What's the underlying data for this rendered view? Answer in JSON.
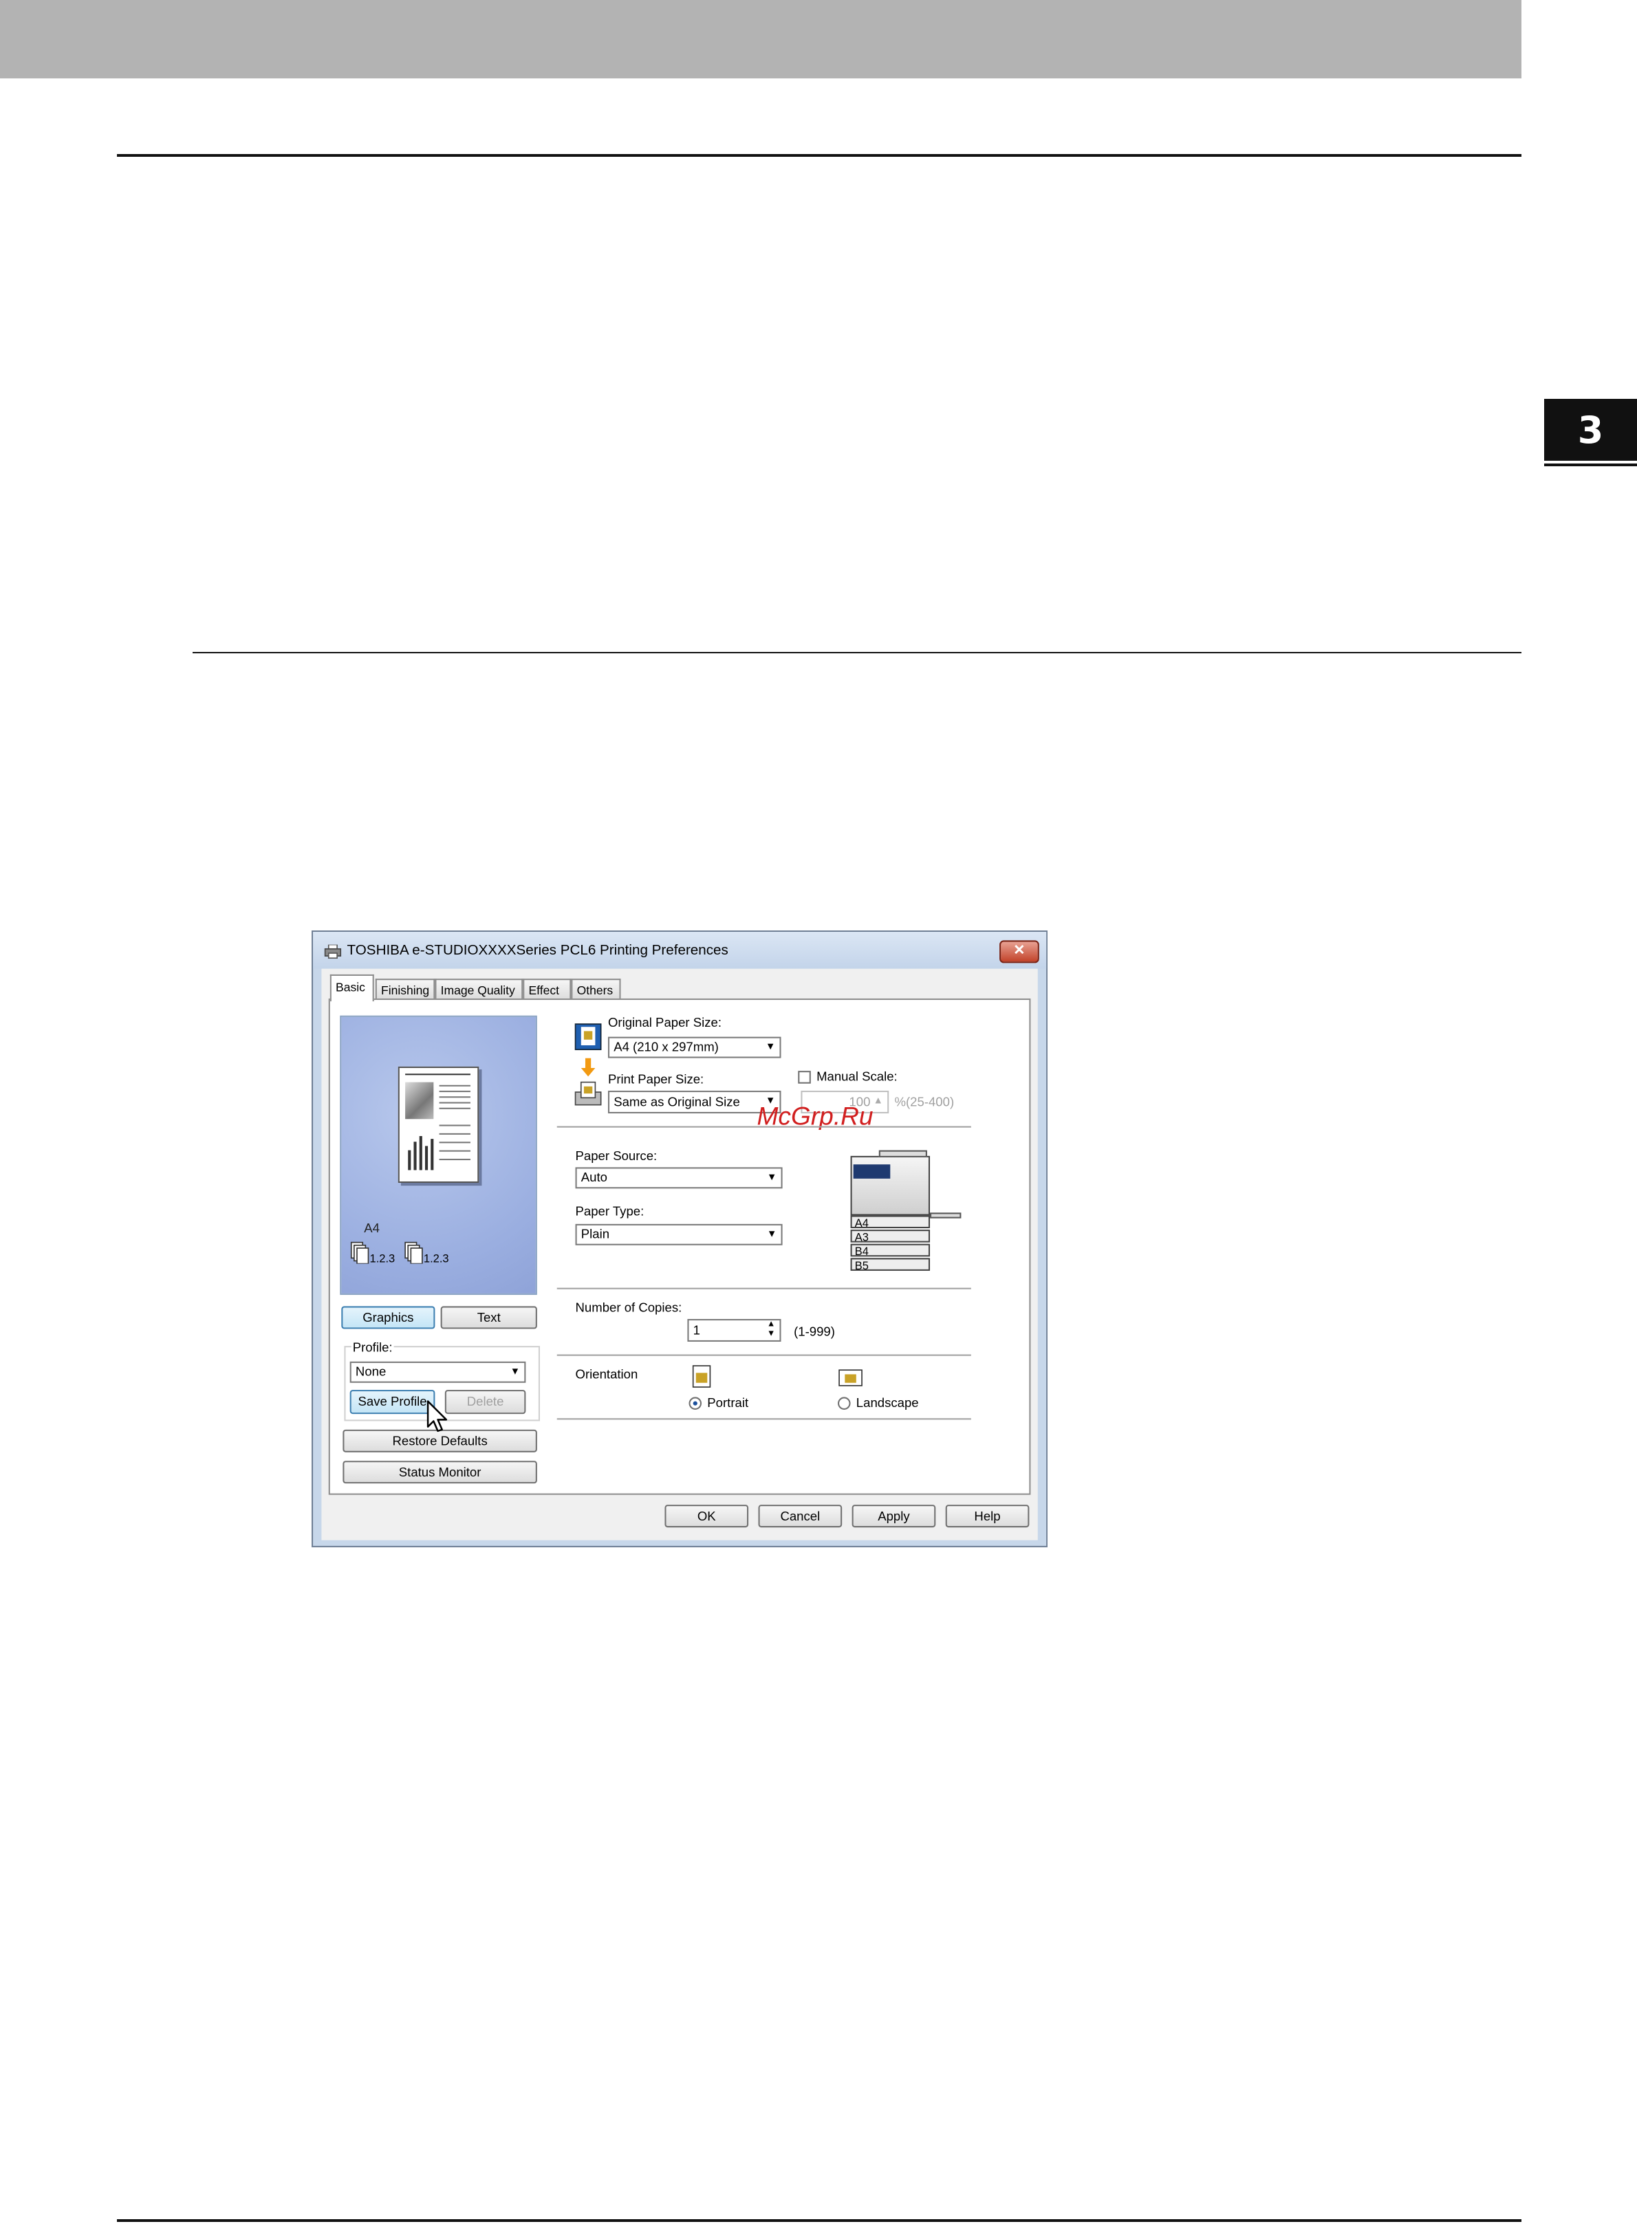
{
  "dialog": {
    "title": "TOSHIBA e-STUDIOXXXXSeries PCL6 Printing Preferences",
    "close_glyph": "✕",
    "tabs": [
      "Basic",
      "Finishing",
      "Image Quality",
      "Effect",
      "Others"
    ],
    "active_tab": "Basic",
    "preview": {
      "paper_size_label": "A4",
      "collate_label_1": "1.2.3",
      "collate_label_2": "1.2.3"
    },
    "view_buttons": {
      "graphics": "Graphics",
      "text": "Text"
    },
    "profile": {
      "label": "Profile:",
      "value": "None",
      "save_button": "Save Profile",
      "delete_button": "Delete"
    },
    "restore_defaults_button": "Restore Defaults",
    "status_monitor_button": "Status Monitor",
    "original_paper_size": {
      "label": "Original Paper Size:",
      "value": "A4 (210 x 297mm)"
    },
    "print_paper_size": {
      "label": "Print Paper Size:",
      "value": "Same as Original Size"
    },
    "manual_scale": {
      "label": "Manual Scale:",
      "value": "100",
      "range": "%(25-400)",
      "checked": false
    },
    "paper_source": {
      "label": "Paper Source:",
      "value": "Auto"
    },
    "paper_type": {
      "label": "Paper Type:",
      "value": "Plain"
    },
    "printer_trays": [
      "A4",
      "A3",
      "B4",
      "B5"
    ],
    "copies": {
      "label": "Number of Copies:",
      "value": "1",
      "range": "(1-999)"
    },
    "orientation": {
      "label": "Orientation",
      "portrait": "Portrait",
      "landscape": "Landscape",
      "selected": "Portrait"
    },
    "footer_buttons": {
      "ok": "OK",
      "cancel": "Cancel",
      "apply": "Apply",
      "help": "Help"
    }
  },
  "watermark": "McGrp.Ru",
  "chapter_tab": "3",
  "colors": {
    "header_band": "#b3b3b3",
    "watermark": "#d11f1f",
    "chapter_tab": "#111111"
  },
  "icons": [
    "printer-icon",
    "close-icon",
    "dropdown-arrow-icon",
    "spinner-icon",
    "mouse-cursor-icon"
  ]
}
